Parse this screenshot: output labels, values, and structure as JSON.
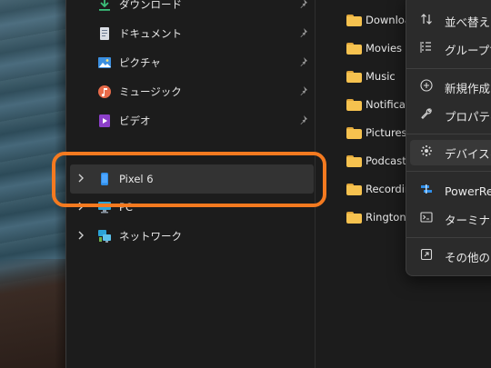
{
  "navigation": {
    "quick_access": [
      {
        "label": "ダウンロード",
        "icon": "download-icon"
      },
      {
        "label": "ドキュメント",
        "icon": "document-icon"
      },
      {
        "label": "ピクチャ",
        "icon": "pictures-icon"
      },
      {
        "label": "ミュージック",
        "icon": "music-icon"
      },
      {
        "label": "ビデオ",
        "icon": "video-icon"
      }
    ],
    "tree": [
      {
        "label": "Pixel 6",
        "icon": "phone-icon",
        "selected": true
      },
      {
        "label": "PC",
        "icon": "pc-icon"
      },
      {
        "label": "ネットワーク",
        "icon": "network-icon"
      }
    ]
  },
  "files": [
    {
      "name": "Download"
    },
    {
      "name": "Movies"
    },
    {
      "name": "Music"
    },
    {
      "name": "Notifications"
    },
    {
      "name": "Pictures"
    },
    {
      "name": "Podcasts"
    },
    {
      "name": "Recordings"
    },
    {
      "name": "Ringtones"
    }
  ],
  "context_menu": {
    "items": [
      {
        "label": "並べ替え",
        "icon": "sort-icon"
      },
      {
        "label": "グループで",
        "icon": "group-icon"
      },
      {
        "label": "新規作成",
        "icon": "new-icon"
      },
      {
        "label": "プロパティ",
        "icon": "properties-icon"
      },
      {
        "label": "デバイスを",
        "icon": "device-settings-icon"
      },
      {
        "label": "PowerRe",
        "icon": "powerrename-icon"
      },
      {
        "label": "ターミナル",
        "icon": "terminal-icon"
      },
      {
        "label": "その他のオ",
        "icon": "more-options-icon"
      }
    ]
  },
  "colors": {
    "highlight": "#f47a20",
    "folder": "#f6c24f",
    "window_bg": "#1c1c1c"
  }
}
